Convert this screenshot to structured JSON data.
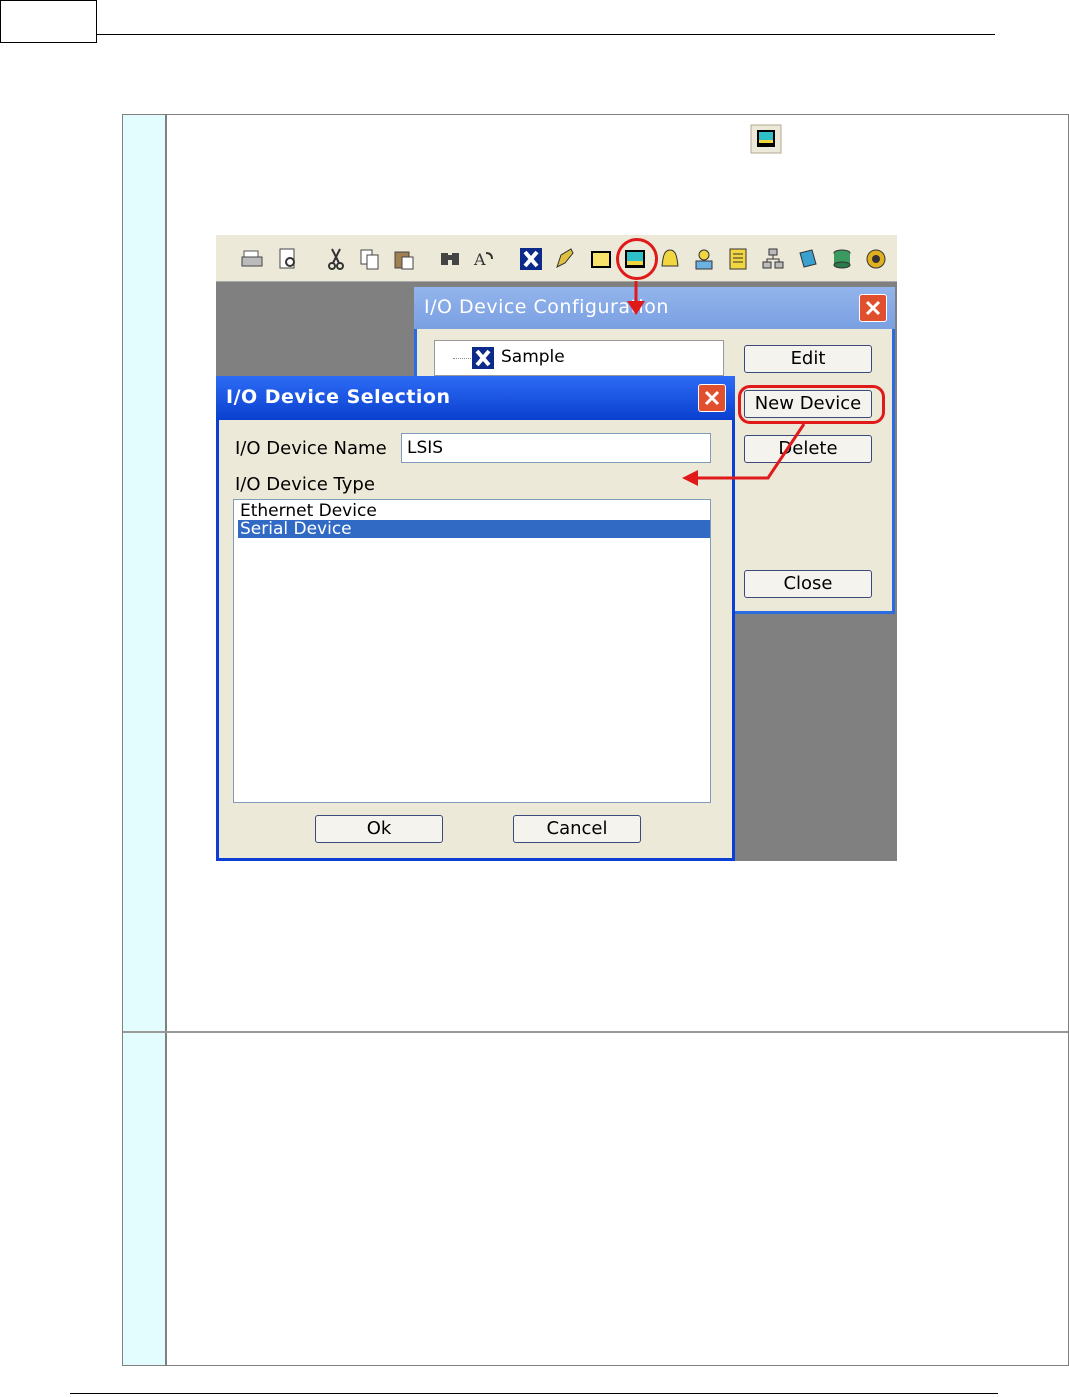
{
  "config_window": {
    "title": "I/O Device Configuration",
    "tree_item": "Sample",
    "buttons": {
      "edit": "Edit",
      "new_device": "New Device",
      "delete": "Delete",
      "close": "Close"
    }
  },
  "selection_dialog": {
    "title": "I/O Device Selection",
    "name_label": "I/O Device Name",
    "name_value": "LSIS",
    "type_label": "I/O Device Type",
    "types": [
      "Ethernet Device",
      "Serial Device"
    ],
    "selected_type": "Serial Device",
    "buttons": {
      "ok": "Ok",
      "cancel": "Cancel"
    }
  },
  "toolbar_icons": [
    "print-icon",
    "print-preview-icon",
    "cut-icon",
    "copy-icon",
    "paste-icon",
    "find-icon",
    "replace-icon",
    "project-x-icon",
    "pencil-icon",
    "window-icon",
    "io-device-icon",
    "alarm-bell-icon",
    "user-icon",
    "script-icon",
    "network-icon",
    "report-icon",
    "database-icon",
    "settings-icon"
  ],
  "colors": {
    "annotation_red": "#e01a1a",
    "active_title": "#0a3fcf",
    "inactive_title": "#7aa0e2",
    "selection_highlight": "#316ac5",
    "table_number_column": "#e3fdff"
  }
}
